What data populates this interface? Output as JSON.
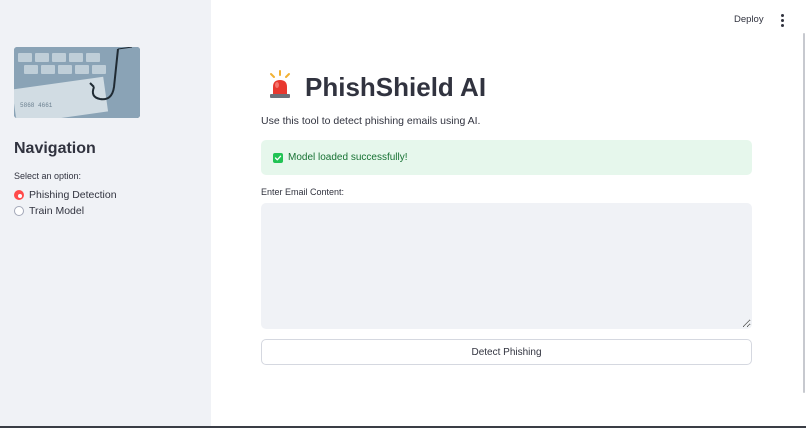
{
  "topbar": {
    "deploy_label": "Deploy",
    "menu_icon": "more-vertical-icon"
  },
  "sidebar": {
    "image_icon": "phishing-hook-keyboard-image",
    "nav_title": "Navigation",
    "select_label": "Select an option:",
    "options": [
      {
        "label": "Phishing Detection",
        "selected": true
      },
      {
        "label": "Train Model",
        "selected": false
      }
    ]
  },
  "main": {
    "title_icon": "rotating-light-icon",
    "title": "PhishShield AI",
    "subtitle": "Use this tool to detect phishing emails using AI.",
    "success_message": "Model loaded successfully!",
    "email_label": "Enter Email Content:",
    "email_value": "",
    "detect_button_label": "Detect Phishing"
  },
  "colors": {
    "accent": "#ff4b4b",
    "sidebar_bg": "#f0f2f6",
    "success_bg": "#e6f7ec",
    "success_text": "#177233",
    "success_check": "#21c354"
  }
}
